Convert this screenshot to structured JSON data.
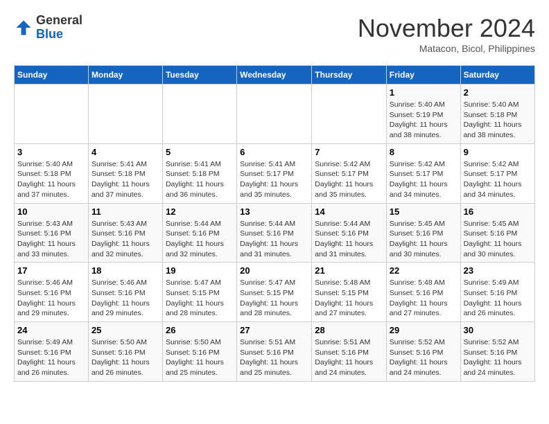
{
  "header": {
    "logo": {
      "general": "General",
      "blue": "Blue"
    },
    "title": "November 2024",
    "subtitle": "Matacon, Bicol, Philippines"
  },
  "calendar": {
    "weekdays": [
      "Sunday",
      "Monday",
      "Tuesday",
      "Wednesday",
      "Thursday",
      "Friday",
      "Saturday"
    ],
    "weeks": [
      [
        {
          "day": "",
          "info": ""
        },
        {
          "day": "",
          "info": ""
        },
        {
          "day": "",
          "info": ""
        },
        {
          "day": "",
          "info": ""
        },
        {
          "day": "",
          "info": ""
        },
        {
          "day": "1",
          "info": "Sunrise: 5:40 AM\nSunset: 5:19 PM\nDaylight: 11 hours and 38 minutes."
        },
        {
          "day": "2",
          "info": "Sunrise: 5:40 AM\nSunset: 5:18 PM\nDaylight: 11 hours and 38 minutes."
        }
      ],
      [
        {
          "day": "3",
          "info": "Sunrise: 5:40 AM\nSunset: 5:18 PM\nDaylight: 11 hours and 37 minutes."
        },
        {
          "day": "4",
          "info": "Sunrise: 5:41 AM\nSunset: 5:18 PM\nDaylight: 11 hours and 37 minutes."
        },
        {
          "day": "5",
          "info": "Sunrise: 5:41 AM\nSunset: 5:18 PM\nDaylight: 11 hours and 36 minutes."
        },
        {
          "day": "6",
          "info": "Sunrise: 5:41 AM\nSunset: 5:17 PM\nDaylight: 11 hours and 35 minutes."
        },
        {
          "day": "7",
          "info": "Sunrise: 5:42 AM\nSunset: 5:17 PM\nDaylight: 11 hours and 35 minutes."
        },
        {
          "day": "8",
          "info": "Sunrise: 5:42 AM\nSunset: 5:17 PM\nDaylight: 11 hours and 34 minutes."
        },
        {
          "day": "9",
          "info": "Sunrise: 5:42 AM\nSunset: 5:17 PM\nDaylight: 11 hours and 34 minutes."
        }
      ],
      [
        {
          "day": "10",
          "info": "Sunrise: 5:43 AM\nSunset: 5:16 PM\nDaylight: 11 hours and 33 minutes."
        },
        {
          "day": "11",
          "info": "Sunrise: 5:43 AM\nSunset: 5:16 PM\nDaylight: 11 hours and 32 minutes."
        },
        {
          "day": "12",
          "info": "Sunrise: 5:44 AM\nSunset: 5:16 PM\nDaylight: 11 hours and 32 minutes."
        },
        {
          "day": "13",
          "info": "Sunrise: 5:44 AM\nSunset: 5:16 PM\nDaylight: 11 hours and 31 minutes."
        },
        {
          "day": "14",
          "info": "Sunrise: 5:44 AM\nSunset: 5:16 PM\nDaylight: 11 hours and 31 minutes."
        },
        {
          "day": "15",
          "info": "Sunrise: 5:45 AM\nSunset: 5:16 PM\nDaylight: 11 hours and 30 minutes."
        },
        {
          "day": "16",
          "info": "Sunrise: 5:45 AM\nSunset: 5:16 PM\nDaylight: 11 hours and 30 minutes."
        }
      ],
      [
        {
          "day": "17",
          "info": "Sunrise: 5:46 AM\nSunset: 5:16 PM\nDaylight: 11 hours and 29 minutes."
        },
        {
          "day": "18",
          "info": "Sunrise: 5:46 AM\nSunset: 5:16 PM\nDaylight: 11 hours and 29 minutes."
        },
        {
          "day": "19",
          "info": "Sunrise: 5:47 AM\nSunset: 5:15 PM\nDaylight: 11 hours and 28 minutes."
        },
        {
          "day": "20",
          "info": "Sunrise: 5:47 AM\nSunset: 5:15 PM\nDaylight: 11 hours and 28 minutes."
        },
        {
          "day": "21",
          "info": "Sunrise: 5:48 AM\nSunset: 5:15 PM\nDaylight: 11 hours and 27 minutes."
        },
        {
          "day": "22",
          "info": "Sunrise: 5:48 AM\nSunset: 5:16 PM\nDaylight: 11 hours and 27 minutes."
        },
        {
          "day": "23",
          "info": "Sunrise: 5:49 AM\nSunset: 5:16 PM\nDaylight: 11 hours and 26 minutes."
        }
      ],
      [
        {
          "day": "24",
          "info": "Sunrise: 5:49 AM\nSunset: 5:16 PM\nDaylight: 11 hours and 26 minutes."
        },
        {
          "day": "25",
          "info": "Sunrise: 5:50 AM\nSunset: 5:16 PM\nDaylight: 11 hours and 26 minutes."
        },
        {
          "day": "26",
          "info": "Sunrise: 5:50 AM\nSunset: 5:16 PM\nDaylight: 11 hours and 25 minutes."
        },
        {
          "day": "27",
          "info": "Sunrise: 5:51 AM\nSunset: 5:16 PM\nDaylight: 11 hours and 25 minutes."
        },
        {
          "day": "28",
          "info": "Sunrise: 5:51 AM\nSunset: 5:16 PM\nDaylight: 11 hours and 24 minutes."
        },
        {
          "day": "29",
          "info": "Sunrise: 5:52 AM\nSunset: 5:16 PM\nDaylight: 11 hours and 24 minutes."
        },
        {
          "day": "30",
          "info": "Sunrise: 5:52 AM\nSunset: 5:16 PM\nDaylight: 11 hours and 24 minutes."
        }
      ]
    ]
  }
}
